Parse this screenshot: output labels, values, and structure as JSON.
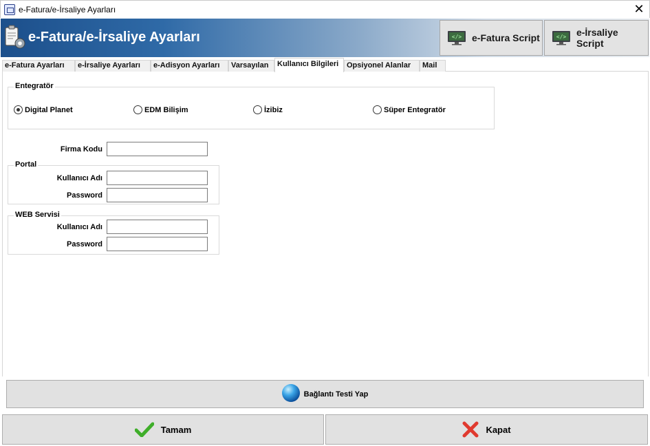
{
  "window": {
    "title": "e-Fatura/e-İrsaliye Ayarları",
    "close_glyph": "✕"
  },
  "header": {
    "title": "e-Fatura/e-İrsaliye Ayarları",
    "efatura_script_label": "e-Fatura Script",
    "eirsaliye_script_label": "e-İrsaliye Script"
  },
  "tabs": [
    {
      "label": "e-Fatura Ayarları"
    },
    {
      "label": "e-İrsaliye Ayarları"
    },
    {
      "label": "e-Adisyon Ayarları"
    },
    {
      "label": "Varsayılan"
    },
    {
      "label": "Kullanıcı Bilgileri",
      "active": true
    },
    {
      "label": "Opsiyonel Alanlar"
    },
    {
      "label": "Mail"
    }
  ],
  "entegrator": {
    "legend": "Entegratör",
    "options": [
      {
        "label": "Digital Planet",
        "selected": true
      },
      {
        "label": "EDM Bilişim",
        "selected": false
      },
      {
        "label": "İzibiz",
        "selected": false
      },
      {
        "label": "Süper Entegratör",
        "selected": false
      }
    ]
  },
  "firma": {
    "label": "Firma Kodu",
    "value": ""
  },
  "portal": {
    "legend": "Portal",
    "username_label": "Kullanıcı Adı",
    "username_value": "",
    "password_label": "Password",
    "password_value": ""
  },
  "webservis": {
    "legend": "WEB Servisi",
    "username_label": "Kullanıcı Adı",
    "username_value": "",
    "password_label": "Password",
    "password_value": ""
  },
  "buttons": {
    "test_label": "Bağlantı Testi Yap",
    "ok_label": "Tamam",
    "close_label": "Kapat"
  },
  "colors": {
    "header_start": "#1c4f8b",
    "ok_check": "#3fae2a",
    "close_x": "#e03a2f"
  }
}
